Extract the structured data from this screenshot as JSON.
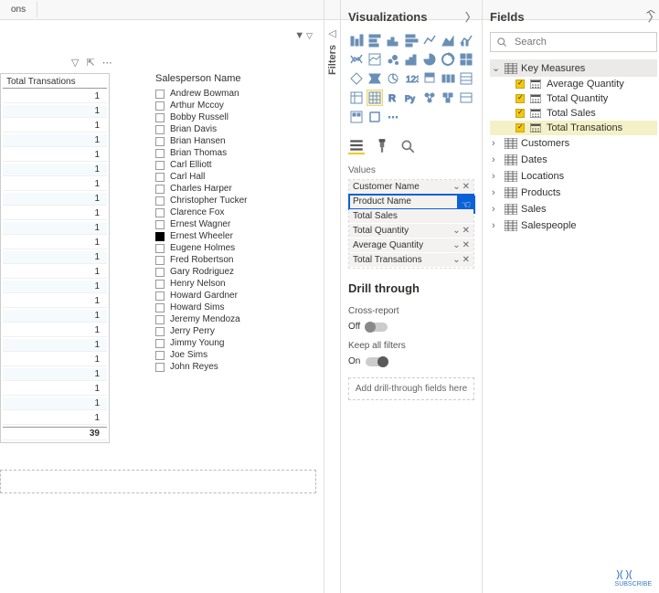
{
  "topbar": {
    "tab": "ons"
  },
  "filters_rail": {
    "label": "Filters"
  },
  "table": {
    "header": "Total Transations",
    "rows": [
      1,
      1,
      1,
      1,
      1,
      1,
      1,
      1,
      1,
      1,
      1,
      1,
      1,
      1,
      1,
      1,
      1,
      1,
      1,
      1,
      1,
      1,
      1
    ],
    "total": 39
  },
  "slicer": {
    "title": "Salesperson Name",
    "items": [
      {
        "label": "Andrew Bowman",
        "checked": false
      },
      {
        "label": "Arthur Mccoy",
        "checked": false
      },
      {
        "label": "Bobby Russell",
        "checked": false
      },
      {
        "label": "Brian Davis",
        "checked": false
      },
      {
        "label": "Brian Hansen",
        "checked": false
      },
      {
        "label": "Brian Thomas",
        "checked": false
      },
      {
        "label": "Carl Elliott",
        "checked": false
      },
      {
        "label": "Carl Hall",
        "checked": false
      },
      {
        "label": "Charles Harper",
        "checked": false
      },
      {
        "label": "Christopher Tucker",
        "checked": false
      },
      {
        "label": "Clarence Fox",
        "checked": false
      },
      {
        "label": "Ernest Wagner",
        "checked": false
      },
      {
        "label": "Ernest Wheeler",
        "checked": true
      },
      {
        "label": "Eugene Holmes",
        "checked": false
      },
      {
        "label": "Fred Robertson",
        "checked": false
      },
      {
        "label": "Gary Rodriguez",
        "checked": false
      },
      {
        "label": "Henry Nelson",
        "checked": false
      },
      {
        "label": "Howard Gardner",
        "checked": false
      },
      {
        "label": "Howard Sims",
        "checked": false
      },
      {
        "label": "Jeremy Mendoza",
        "checked": false
      },
      {
        "label": "Jerry Perry",
        "checked": false
      },
      {
        "label": "Jimmy Young",
        "checked": false
      },
      {
        "label": "Joe Sims",
        "checked": false
      },
      {
        "label": "John Reyes",
        "checked": false
      }
    ]
  },
  "viz": {
    "title": "Visualizations",
    "values_label": "Values",
    "wells": [
      {
        "name": "Customer Name"
      },
      {
        "name": "Product Name"
      },
      {
        "name": "Total Sales"
      },
      {
        "name": "Total Quantity"
      },
      {
        "name": "Average Quantity"
      },
      {
        "name": "Total Transations"
      }
    ],
    "drill_title": "Drill through",
    "cross_report_label": "Cross-report",
    "cross_report_state": "Off",
    "keep_filters_label": "Keep all filters",
    "keep_filters_state": "On",
    "drop_hint": "Add drill-through fields here"
  },
  "fields": {
    "title": "Fields",
    "search_placeholder": "Search",
    "tables": [
      {
        "name": "Key Measures",
        "expanded": true,
        "highlight": true,
        "children": [
          {
            "name": "Average Quantity",
            "checked": true
          },
          {
            "name": "Total Quantity",
            "checked": true
          },
          {
            "name": "Total Sales",
            "checked": true
          },
          {
            "name": "Total Transations",
            "checked": true,
            "selected": true
          }
        ]
      },
      {
        "name": "Customers",
        "expanded": false
      },
      {
        "name": "Dates",
        "expanded": false
      },
      {
        "name": "Locations",
        "expanded": false
      },
      {
        "name": "Products",
        "expanded": false
      },
      {
        "name": "Sales",
        "expanded": false
      },
      {
        "name": "Salespeople",
        "expanded": false
      }
    ]
  },
  "watermark": "SUBSCRIBE"
}
